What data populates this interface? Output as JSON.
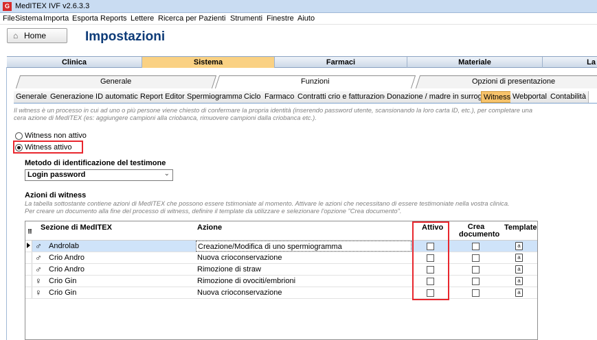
{
  "window": {
    "app_icon": "G",
    "title": "MedITEX IVF v2.6.3.3"
  },
  "menu": [
    "File",
    "Sistema",
    "Importa",
    "Esporta",
    "Reports",
    "Lettere",
    "Ricerca per Pazienti",
    "Strumenti",
    "Finestre",
    "Aiuto"
  ],
  "home_button": {
    "icon": "home-icon",
    "label": "Home"
  },
  "page_title": "Impostazioni",
  "top_tabs": [
    {
      "label": "Clinica",
      "active": false
    },
    {
      "label": "Sistema",
      "active": true
    },
    {
      "label": "Farmaci",
      "active": false
    },
    {
      "label": "Materiale",
      "active": false
    },
    {
      "label": "La",
      "active": false
    }
  ],
  "level2_tabs": [
    {
      "label": "Generale",
      "active": false
    },
    {
      "label": "Funzioni",
      "active": true
    },
    {
      "label": "Opzioni di presentazione",
      "active": false
    }
  ],
  "level3_tabs": [
    {
      "label": "Generale",
      "active": false
    },
    {
      "label": "Generazione ID automatica",
      "active": false
    },
    {
      "label": "Report Editor",
      "active": false
    },
    {
      "label": "Spermiogramma",
      "active": false
    },
    {
      "label": "Ciclo",
      "active": false
    },
    {
      "label": "Farmaco",
      "active": false
    },
    {
      "label": "Contratti crio e fatturazione",
      "active": false
    },
    {
      "label": "Donazione / madre in surroga",
      "active": false
    },
    {
      "label": "Witness",
      "active": true
    },
    {
      "label": "Webportal",
      "active": false
    },
    {
      "label": "Contabilità",
      "active": false
    }
  ],
  "description": "Il witness è un processo in cui ad uno o più persone viene chiesto di confermare la propria identità (inserendo password utente, scansionando la loro carta ID, etc.), per completare una cera azione di MedITEX (es: aggiungere campioni alla criobanca, rimuovere campioni dalla criobanca etc.).",
  "witness_options": {
    "off_label": "Witness non attivo",
    "on_label": "Witness attivo",
    "selected": "on"
  },
  "identification": {
    "label": "Metodo di identificazione del testimone",
    "value": "Login password"
  },
  "actions_section": {
    "title": "Azioni di witness",
    "description_line1": "La tabella sottostante contiene azioni di MedITEX che possono essere tstimoniate al momento. Attivare le azioni che necessitano di essere testimoniate nella vostra clinica.",
    "description_line2": "Per creare un documento alla fine del processo di witness, definire il template da utilizzare e selezionare l'opzione \"Crea documento\"."
  },
  "table": {
    "headers": {
      "grip": "⠿",
      "section": "Sezione di MedITEX",
      "action": "Azione",
      "active": "Attivo",
      "create_doc": "Crea documento",
      "template": "Template"
    },
    "rows": [
      {
        "sex": "♂",
        "section": "Androlab",
        "action": "Creazione/Modifica di uno spermiogramma",
        "active": false,
        "create_doc": false,
        "selected": true
      },
      {
        "sex": "♂",
        "section": "Crio Andro",
        "action": "Nuova crioconservazione",
        "active": false,
        "create_doc": false,
        "selected": false
      },
      {
        "sex": "♂",
        "section": "Crio Andro",
        "action": "Rimozione di straw",
        "active": false,
        "create_doc": false,
        "selected": false
      },
      {
        "sex": "♀",
        "section": "Crio Gin",
        "action": "Rimozione di ovociti/embrioni",
        "active": false,
        "create_doc": false,
        "selected": false
      },
      {
        "sex": "♀",
        "section": "Crio Gin",
        "action": "Nuova crioconservazione",
        "active": false,
        "create_doc": false,
        "selected": false
      }
    ],
    "template_icon_glyph": "a"
  },
  "colors": {
    "active_top_tab": "#fad183",
    "active_l3_tab": "#f7c36b",
    "highlight_box": "#e8262d",
    "selected_row": "#cfe3f9",
    "title_blue": "#0d3b78"
  }
}
